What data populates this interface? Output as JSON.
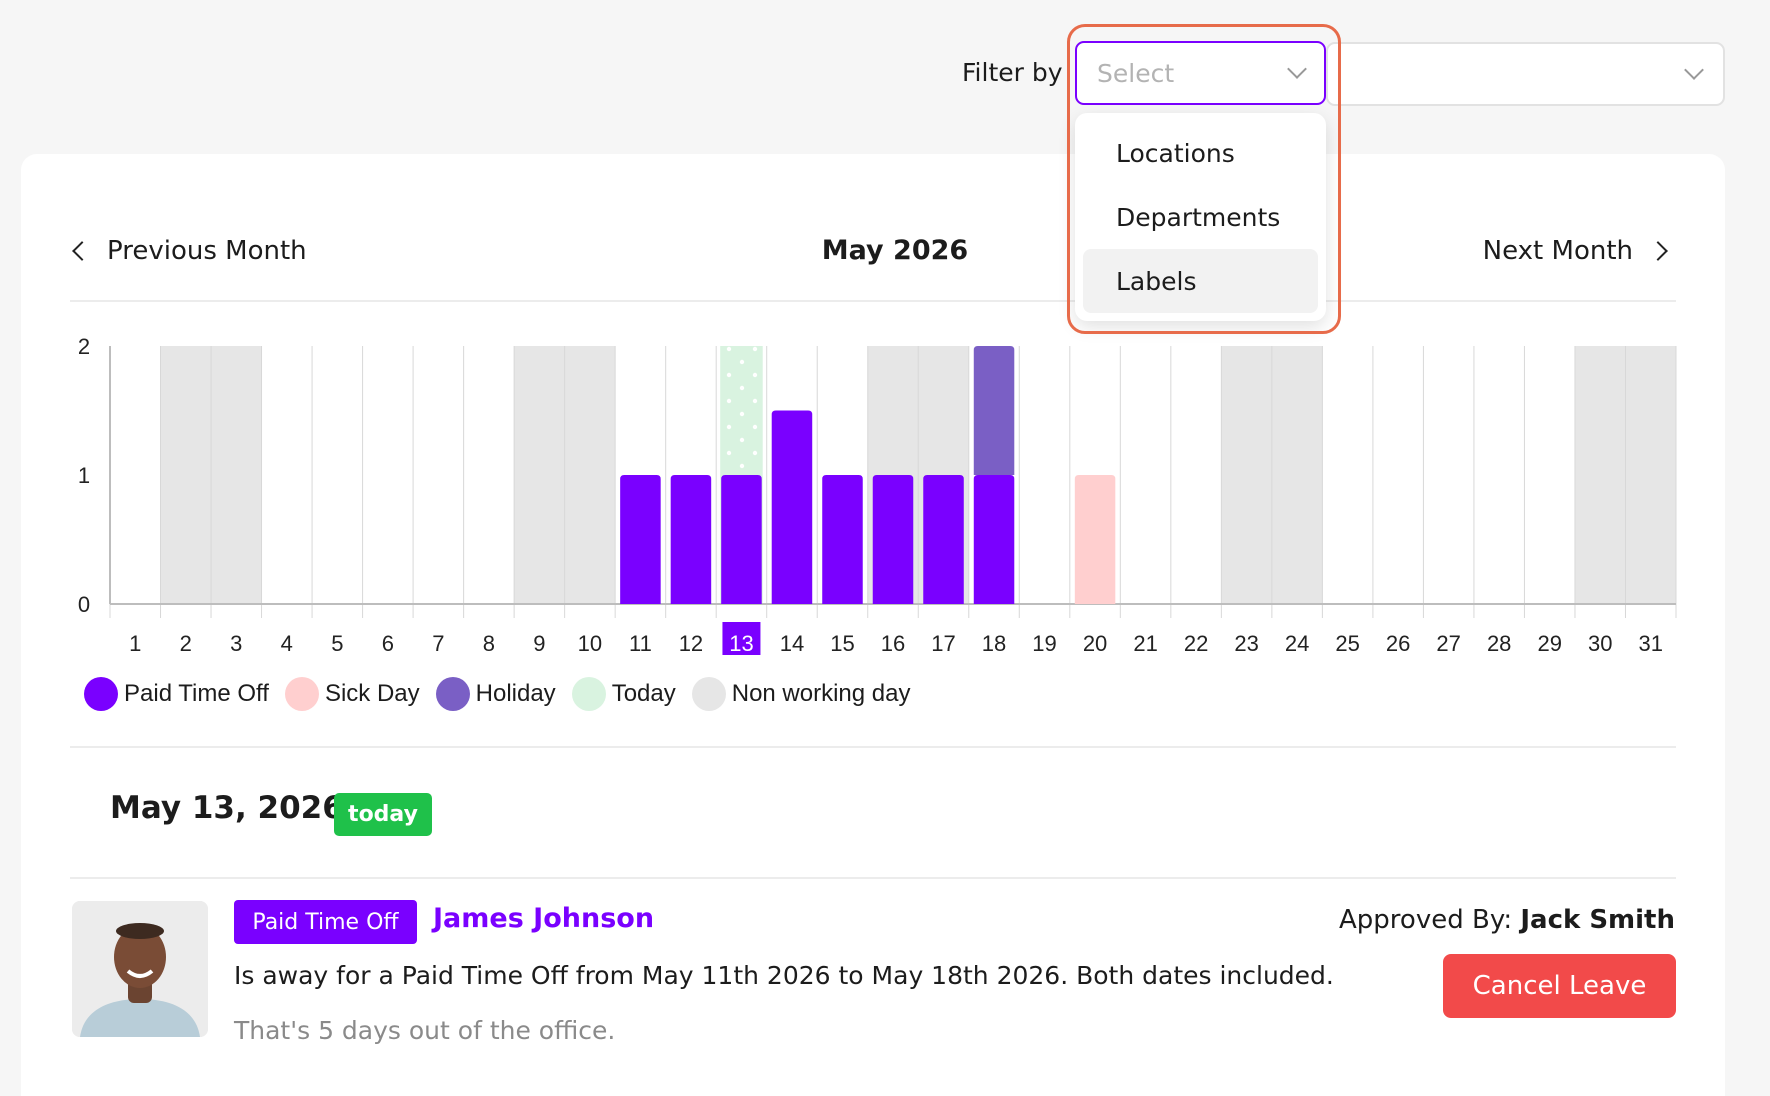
{
  "filter": {
    "label": "Filter by",
    "select_placeholder": "Select",
    "options": [
      "Locations",
      "Departments",
      "Labels"
    ],
    "highlighted_option": "Labels"
  },
  "calendar_nav": {
    "previous_label": "Previous Month",
    "next_label": "Next Month",
    "month_title": "May 2026"
  },
  "chart_data": {
    "type": "bar",
    "stacked": true,
    "x_categories": [
      "1",
      "2",
      "3",
      "4",
      "5",
      "6",
      "7",
      "8",
      "9",
      "10",
      "11",
      "12",
      "13",
      "14",
      "15",
      "16",
      "17",
      "18",
      "19",
      "20",
      "21",
      "22",
      "23",
      "24",
      "25",
      "26",
      "27",
      "28",
      "29",
      "30",
      "31"
    ],
    "ylim": [
      0,
      2
    ],
    "y_ticks": [
      0,
      1,
      2
    ],
    "today": 13,
    "non_working_days": [
      2,
      3,
      9,
      10,
      16,
      17,
      23,
      24,
      30,
      31
    ],
    "series": [
      {
        "name": "Paid Time Off",
        "color": "#7a00ff",
        "values": [
          0,
          0,
          0,
          0,
          0,
          0,
          0,
          0,
          0,
          0,
          1,
          1,
          1,
          1.5,
          1,
          1,
          1,
          1,
          0,
          0,
          0,
          0,
          0,
          0,
          0,
          0,
          0,
          0,
          0,
          0,
          0
        ]
      },
      {
        "name": "Sick Day",
        "color": "#ffcfcf",
        "values": [
          0,
          0,
          0,
          0,
          0,
          0,
          0,
          0,
          0,
          0,
          0,
          0,
          0,
          0,
          0,
          0,
          0,
          0,
          0,
          1,
          0,
          0,
          0,
          0,
          0,
          0,
          0,
          0,
          0,
          0,
          0
        ]
      },
      {
        "name": "Holiday",
        "color": "#7a5fc5",
        "values": [
          0,
          0,
          0,
          0,
          0,
          0,
          0,
          0,
          0,
          0,
          0,
          0,
          0,
          0,
          0,
          0,
          0,
          1,
          0,
          0,
          0,
          0,
          0,
          0,
          0,
          0,
          0,
          0,
          0,
          0,
          0
        ]
      }
    ],
    "legend": [
      {
        "name": "Paid Time Off",
        "color": "#7a00ff"
      },
      {
        "name": "Sick Day",
        "color": "#ffcfcf"
      },
      {
        "name": "Holiday",
        "color": "#7a5fc5"
      },
      {
        "name": "Today",
        "color": "#d9f3e0"
      },
      {
        "name": "Non working day",
        "color": "#e6e6e6"
      }
    ]
  },
  "day_detail": {
    "date": "May 13, 2026",
    "badge": "today",
    "entry": {
      "type": "Paid Time Off",
      "name": "James Johnson",
      "approved_label": "Approved By:",
      "approved_by": "Jack Smith",
      "description": "Is away for a Paid Time Off from May 11th 2026 to May 18th 2026. Both dates included.",
      "days_out": "That's 5 days out of the office.",
      "cancel_label": "Cancel Leave"
    }
  }
}
